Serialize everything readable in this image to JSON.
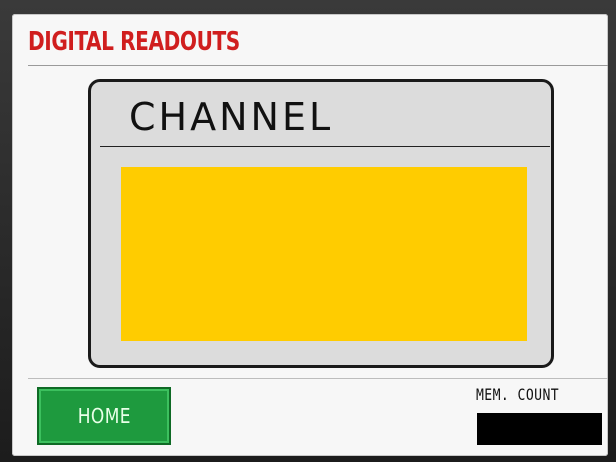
{
  "header": {
    "title": "DIGITAL READOUTS"
  },
  "panel": {
    "label": "CHANNEL",
    "readout_value": ""
  },
  "footer": {
    "home_label": "HOME",
    "mem_count_label": "MEM. COUNT",
    "mem_count_value": ""
  },
  "colors": {
    "title_red": "#d01e1e",
    "readout_yellow": "#ffcc00",
    "home_green": "#1e9a3e",
    "mem_display": "#000000"
  }
}
